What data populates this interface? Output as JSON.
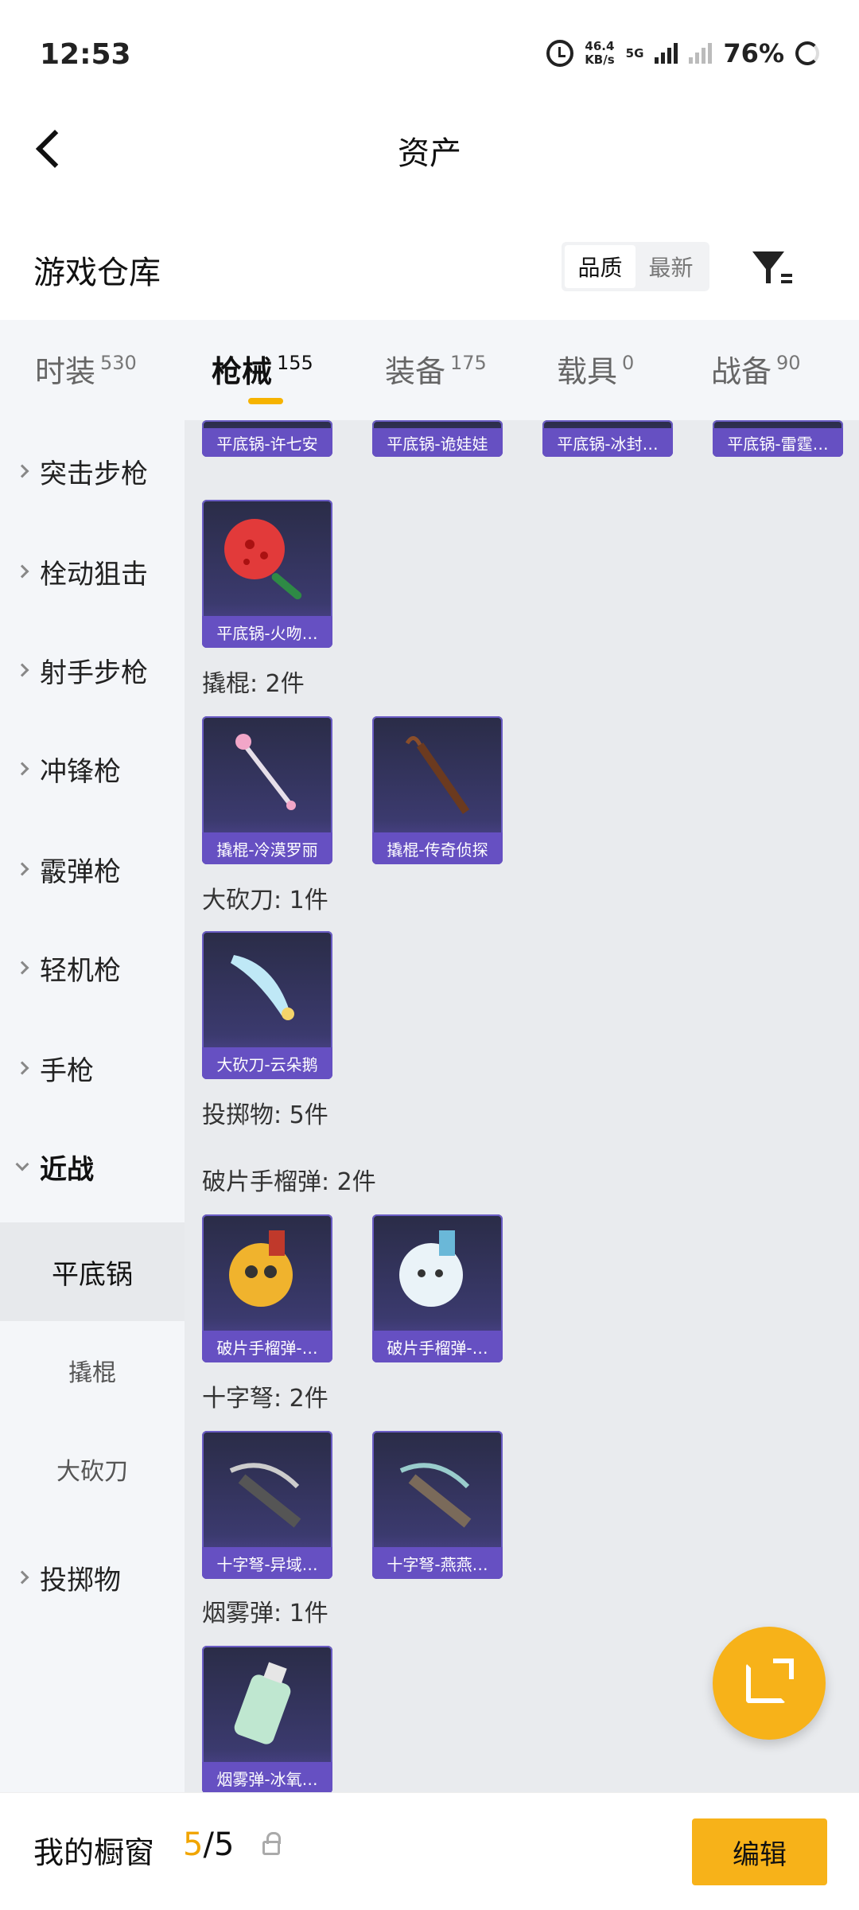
{
  "status_bar": {
    "time": "12:53",
    "speed": "46.4",
    "speed_unit": "KB/s",
    "net_type": "5G",
    "battery": "76%"
  },
  "nav": {
    "title": "资产"
  },
  "warehouse": {
    "title": "游戏仓库",
    "sort_options": [
      "品质",
      "最新"
    ],
    "sort_selected": "品质"
  },
  "tabs": [
    {
      "label": "时装",
      "count": "530"
    },
    {
      "label": "枪械",
      "count": "155"
    },
    {
      "label": "装备",
      "count": "175"
    },
    {
      "label": "载具",
      "count": "0"
    },
    {
      "label": "战备",
      "count": "90"
    }
  ],
  "side_menu": {
    "items": [
      "突击步枪",
      "栓动狙击",
      "射手步枪",
      "冲锋枪",
      "霰弹枪",
      "轻机枪",
      "手枪",
      "近战"
    ],
    "sub_items": [
      "平底锅",
      "撬棍",
      "大砍刀"
    ],
    "last_item": "投掷物"
  },
  "content": {
    "top_row": [
      "平底锅-许七安",
      "平底锅-诡娃娃",
      "平底锅-冰封…",
      "平底锅-雷霆…"
    ],
    "pan_card": "平底锅-火吻…",
    "sections": [
      {
        "title": "撬棍: 2件",
        "cards": [
          "撬棍-冷漠罗丽",
          "撬棍-传奇侦探"
        ]
      },
      {
        "title": "大砍刀: 1件",
        "cards": [
          "大砍刀-云朵鹅"
        ]
      },
      {
        "title": "投掷物: 5件",
        "cards": []
      },
      {
        "title": "破片手榴弹: 2件",
        "cards": [
          "破片手榴弹-…",
          "破片手榴弹-…"
        ]
      },
      {
        "title": "十字弩: 2件",
        "cards": [
          "十字弩-异域…",
          "十字弩-燕燕…"
        ]
      },
      {
        "title": "烟雾弹: 1件",
        "cards": [
          "烟雾弹-冰氧…"
        ]
      }
    ]
  },
  "bottom": {
    "label": "我的橱窗",
    "current": "5",
    "separator": "/",
    "total": "5",
    "edit_label": "编辑"
  },
  "colors": {
    "accent": "#f7b219",
    "card_caption": "#6650c2",
    "card_bg": "#2a2c47"
  }
}
